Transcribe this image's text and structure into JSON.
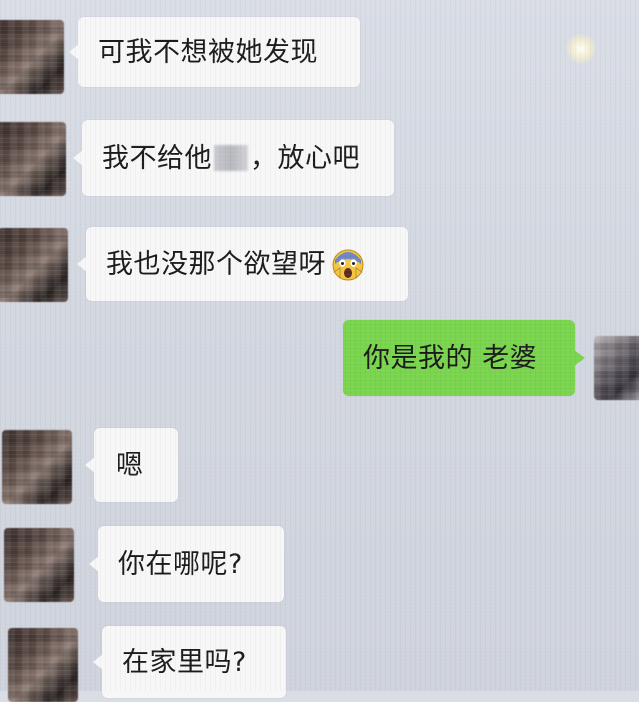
{
  "messages": [
    {
      "side": "left",
      "text": "可我不想被她发现"
    },
    {
      "side": "left",
      "text_before": "我不给他",
      "text_after": "，放心吧"
    },
    {
      "side": "left",
      "text": "我也没那个欲望呀",
      "emoji": "face-screaming-in-fear-icon"
    },
    {
      "side": "right",
      "text": "你是我的 老婆"
    },
    {
      "side": "left",
      "text": "嗯"
    },
    {
      "side": "left",
      "text": "你在哪呢?"
    },
    {
      "side": "left",
      "text": "在家里吗?"
    }
  ],
  "colors": {
    "background": "#d6dae3",
    "incoming_bubble": "#f7f7f8",
    "outgoing_bubble": "#79d54c"
  }
}
